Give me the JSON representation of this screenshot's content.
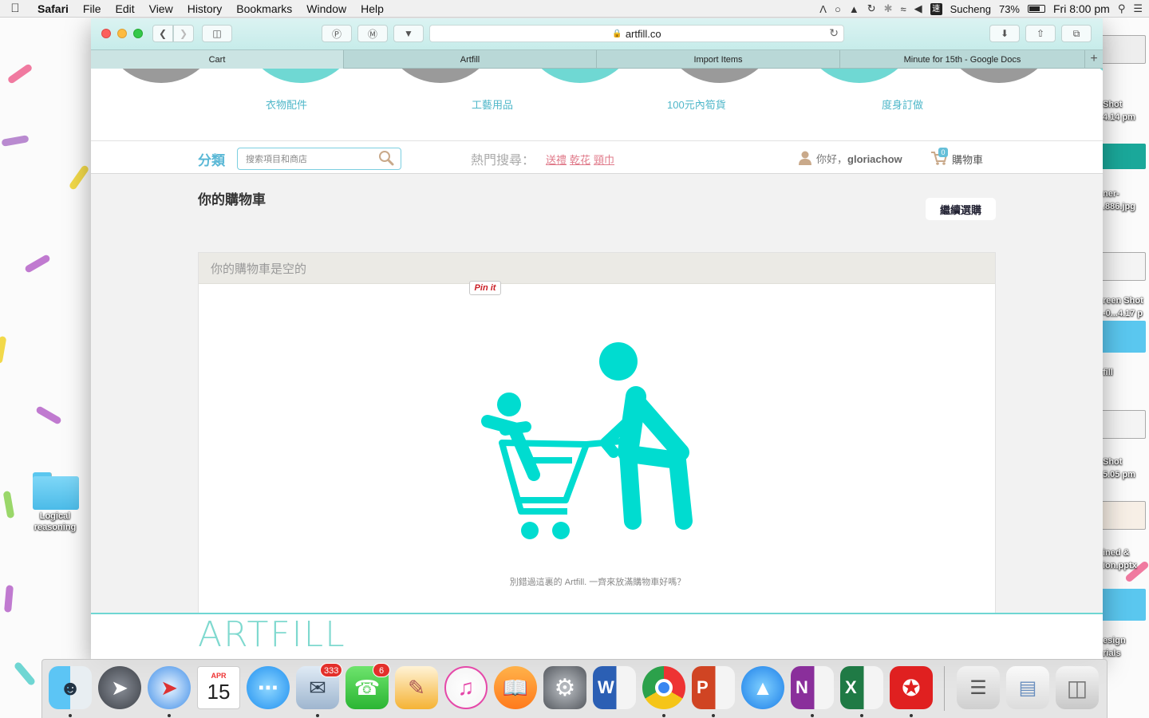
{
  "menubar": {
    "app_name": "Safari",
    "menus": [
      "File",
      "Edit",
      "View",
      "History",
      "Bookmarks",
      "Window",
      "Help"
    ],
    "ime_label": "速",
    "ime_name": "Sucheng",
    "battery": "73%",
    "battery_level": 0.73,
    "clock": "Fri 8:00 pm"
  },
  "browser": {
    "url": "artfill.co",
    "tabs": [
      "Cart",
      "Artfill",
      "Import Items",
      "Minute for 15th - Google Docs"
    ],
    "active_tab": 0
  },
  "site": {
    "categories": [
      "衣物配件",
      "工藝用品",
      "100元內筍貨",
      "度身訂做"
    ],
    "fenlei_label": "分類",
    "search_placeholder": "搜索項目和商店",
    "hot_label": "熱門搜尋：",
    "hot_links": [
      "送禮",
      "乾花",
      "頸巾"
    ],
    "greeting": "你好，",
    "username": "gloriachow",
    "cart_count": "0",
    "cart_label": "購物車",
    "page_title": "你的購物車",
    "continue_button": "繼續選購",
    "empty_heading": "你的購物車是空的",
    "pinit_label": "Pin it",
    "empty_message": "別錯過這裏的 Artfill. 一齊來放滿購物車好嗎？",
    "footer_logo": "ARTFILL"
  },
  "desktop": {
    "folder_label_line1": "Logical",
    "folder_label_line2": "reasoning",
    "right_labels": [
      "Shot",
      "4.14 pm",
      "ner-",
      ".886.jpg",
      "reen Shot",
      "-0...4.17 p",
      "fill",
      "Shot",
      "5.05 pm",
      "ined &",
      "ion.pptx",
      "esign",
      "rials"
    ]
  },
  "dock": {
    "apps": [
      "Finder",
      "Launchpad",
      "Safari",
      "Calendar",
      "Messages",
      "Mail",
      "FaceTime",
      "Pages",
      "iTunes",
      "iBooks",
      "System Preferences",
      "Word",
      "Chrome",
      "PowerPoint",
      "App Store",
      "OneNote",
      "Excel",
      "Acrobat",
      "Notebook",
      "Documents",
      "Trash"
    ],
    "calendar_month": "APR",
    "calendar_day": "15",
    "mail_badge": "333",
    "facetime_badge": "6"
  },
  "colors": {
    "teal": "#00dcd0",
    "link_blue": "#4fb7c9",
    "hot_pink": "#e07a8a"
  }
}
